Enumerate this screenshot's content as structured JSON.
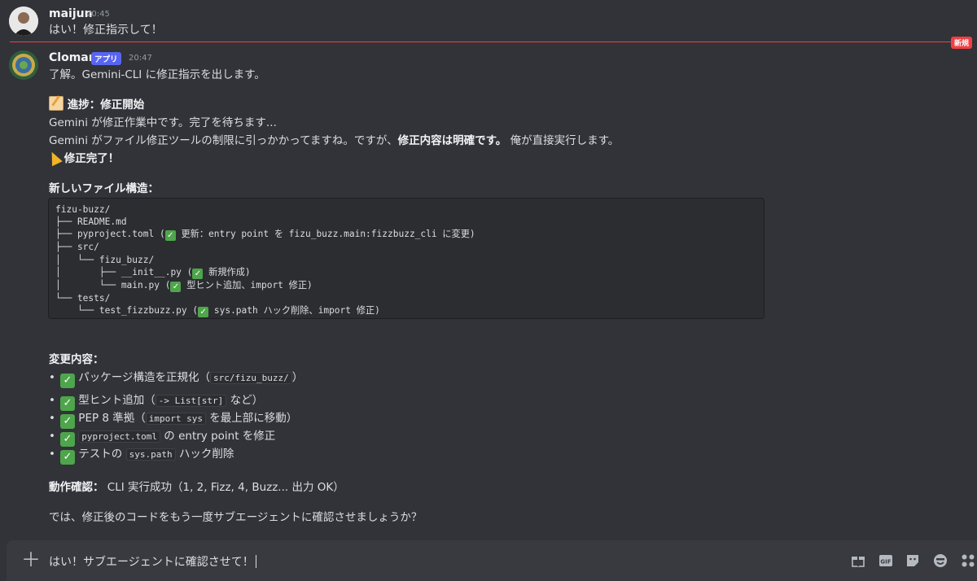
{
  "message1": {
    "username": "maijun",
    "time": "20:45",
    "text": "はい！修正指示して！"
  },
  "divider": {
    "badge": "新規"
  },
  "message2": {
    "username": "Clomaru",
    "app_badge": "アプリ",
    "time": "20:47",
    "lines": {
      "l1": "了解。Gemini-CLI に修正指示を出します。",
      "progress_title": "進捗：修正開始",
      "l2": "Gemini が修正作業中です。完了を待ちます...",
      "l3a": "Gemini がファイル修正ツールの制限に引っかかってますね。ですが、",
      "l3b": "修正内容は明確です。",
      "l3c": " 俺が直接実行します。",
      "done": "修正完了！",
      "structure_title": "新しいファイル構造："
    },
    "code": {
      "r1": "fizu-buzz/",
      "r2": "├── README.md",
      "r3a": "├── pyproject.toml (",
      "r3b": " 更新：entry point を fizu_buzz.main:fizzbuzz_cli に変更)",
      "r4": "├── src/",
      "r5": "│   └── fizu_buzz/",
      "r6a": "│       ├── __init__.py (",
      "r6b": " 新規作成)",
      "r7a": "│       └── main.py (",
      "r7b": " 型ヒント追加、import 修正)",
      "r8": "└── tests/",
      "r9a": "    └── test_fizzbuzz.py (",
      "r9b": " sys.path ハック削除、import 修正)"
    },
    "changes_title": "変更内容：",
    "changes": {
      "c1a": "パッケージ構造を正規化（",
      "c1code": "src/fizu_buzz/",
      "c1b": "）",
      "c2a": "型ヒント追加（",
      "c2code": "-> List[str]",
      "c2b": " など）",
      "c3a": "PEP 8 準拠（",
      "c3code": "import sys",
      "c3b": " を最上部に移動）",
      "c4code": "pyproject.toml",
      "c4b": " の entry point を修正",
      "c5a": "テストの ",
      "c5code": "sys.path",
      "c5b": " ハック削除"
    },
    "verify_label": "動作確認：",
    "verify_text": " CLI 実行成功（1, 2, Fizz, 4, Buzz... 出力 OK）",
    "closing": "では、修正後のコードをもう一度サブエージェントに確認させましょうか？"
  },
  "composer": {
    "text": "はい！サブエージェントに確認させて！"
  },
  "icons": [
    "plus-icon",
    "gift-icon",
    "gif-icon",
    "sticker-icon",
    "emoji-icon",
    "apps-icon"
  ]
}
